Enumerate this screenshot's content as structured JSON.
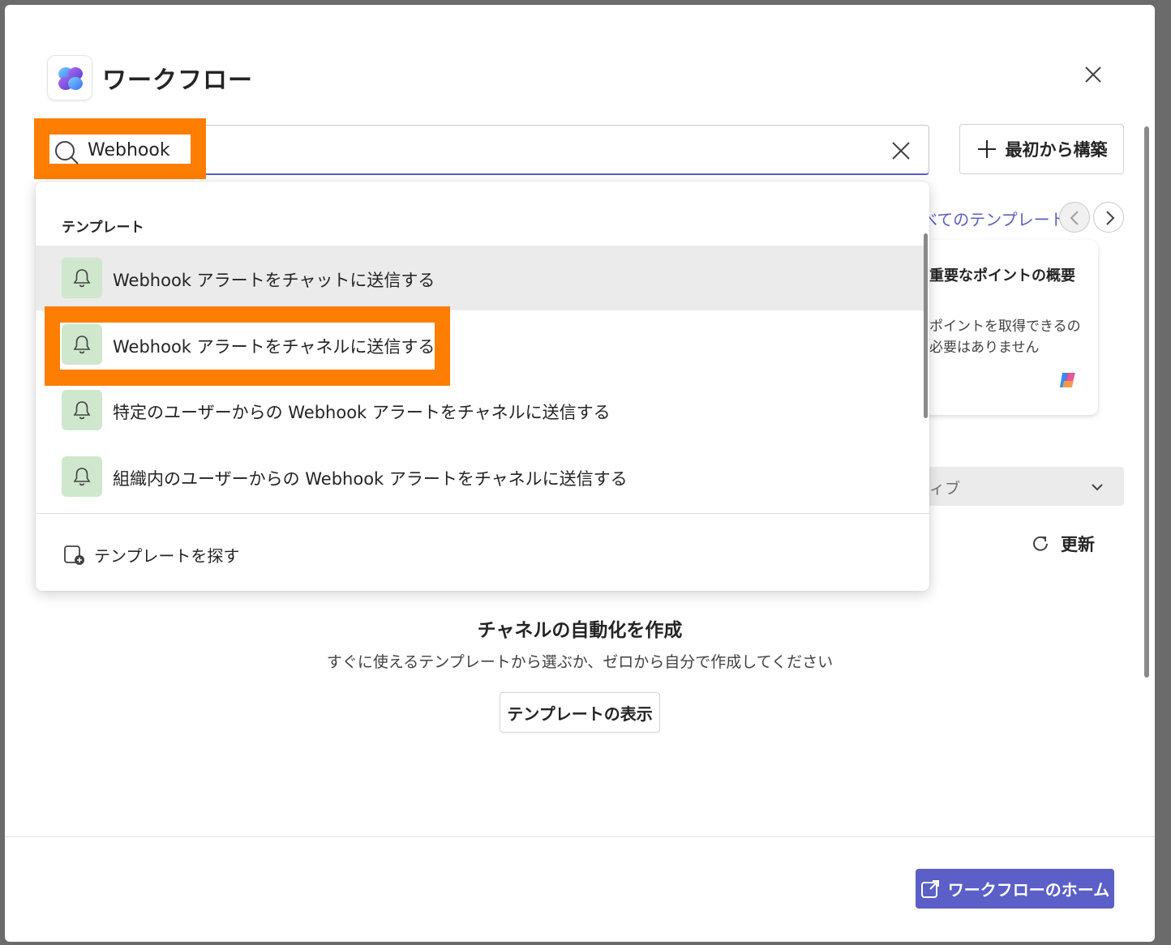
{
  "dialog": {
    "title": "ワークフロー",
    "icons": {
      "logo": "workflows-logo",
      "close": "close-icon"
    }
  },
  "search": {
    "value": "Webhook",
    "icon": "search-icon",
    "clear_icon": "dismiss-icon"
  },
  "toolbar": {
    "build_label": "最初から構築",
    "build_icon": "plus-icon"
  },
  "background": {
    "all_templates_link": "べてのテンプレート",
    "card": {
      "title": "重要なポイントの概要",
      "desc_line1": "ポイントを取得できるの",
      "desc_line2": "必要はありません",
      "icon": "copilot-icon"
    },
    "filter_value": "ィブ",
    "refresh_label": "更新",
    "empty_state": {
      "title": "チャネルの自動化を作成",
      "description": "すぐに使えるテンプレートから選ぶか、ゼロから自分で作成してください",
      "button": "テンプレートの表示"
    }
  },
  "dropdown": {
    "heading": "テンプレート",
    "items": [
      {
        "label": "Webhook アラートをチャットに送信する",
        "icon": "bell-icon"
      },
      {
        "label": "Webhook アラートをチャネルに送信する",
        "icon": "bell-icon"
      },
      {
        "label": "特定のユーザーからの Webhook アラートをチャネルに送信する",
        "icon": "bell-icon"
      },
      {
        "label": "組織内のユーザーからの Webhook アラートをチャネルに送信する",
        "icon": "bell-icon"
      }
    ],
    "find_label": "テンプレートを探す",
    "find_icon": "template-add-icon"
  },
  "footer": {
    "home_label": "ワークフローのホーム",
    "home_icon": "open-external-icon"
  },
  "colors": {
    "accent": "#5b5fc7",
    "highlight": "#fd7e00",
    "icon_bg": "#cfe7cc"
  }
}
